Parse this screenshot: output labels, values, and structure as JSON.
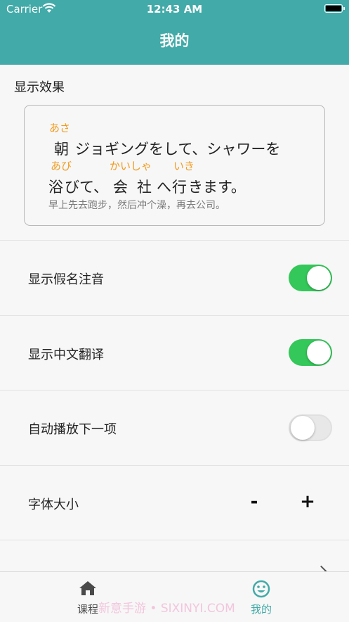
{
  "status_bar": {
    "carrier": "Carrier",
    "time": "12:43 AM"
  },
  "nav": {
    "title": "我的"
  },
  "preview": {
    "section_label": "显示效果",
    "ruby": {
      "asa": "あさ",
      "abi": "あび",
      "kaisha": "かいしゃ",
      "iki": "いき"
    },
    "line1_kanji": "朝",
    "line1_rest": "ジョギングをして、シャワーを",
    "line2_abi": "浴",
    "line2_a": "びて、",
    "line2_kai": "会",
    "line2_sha": "社",
    "line2_he": "へ",
    "line2_iki": "行",
    "line2_end": "きます。",
    "translation": "早上先去跑步，然后冲个澡，再去公司。"
  },
  "settings": [
    {
      "label": "显示假名注音",
      "enabled": true
    },
    {
      "label": "显示中文翻译",
      "enabled": true
    },
    {
      "label": "自动播放下一项",
      "enabled": false
    }
  ],
  "font_size": {
    "label": "字体大小",
    "decrease": "-",
    "increase": "+"
  },
  "tabs": [
    {
      "label": "课程",
      "icon": "home-icon",
      "active": false
    },
    {
      "label": "我的",
      "icon": "smiley-icon",
      "active": true
    }
  ],
  "watermark": "新意手游 • SIXINYI.COM",
  "colors": {
    "accent": "#42aaa8",
    "ruby": "#f29a1d",
    "toggle_on": "#34c759",
    "tab_inactive": "#4a4a4a"
  }
}
